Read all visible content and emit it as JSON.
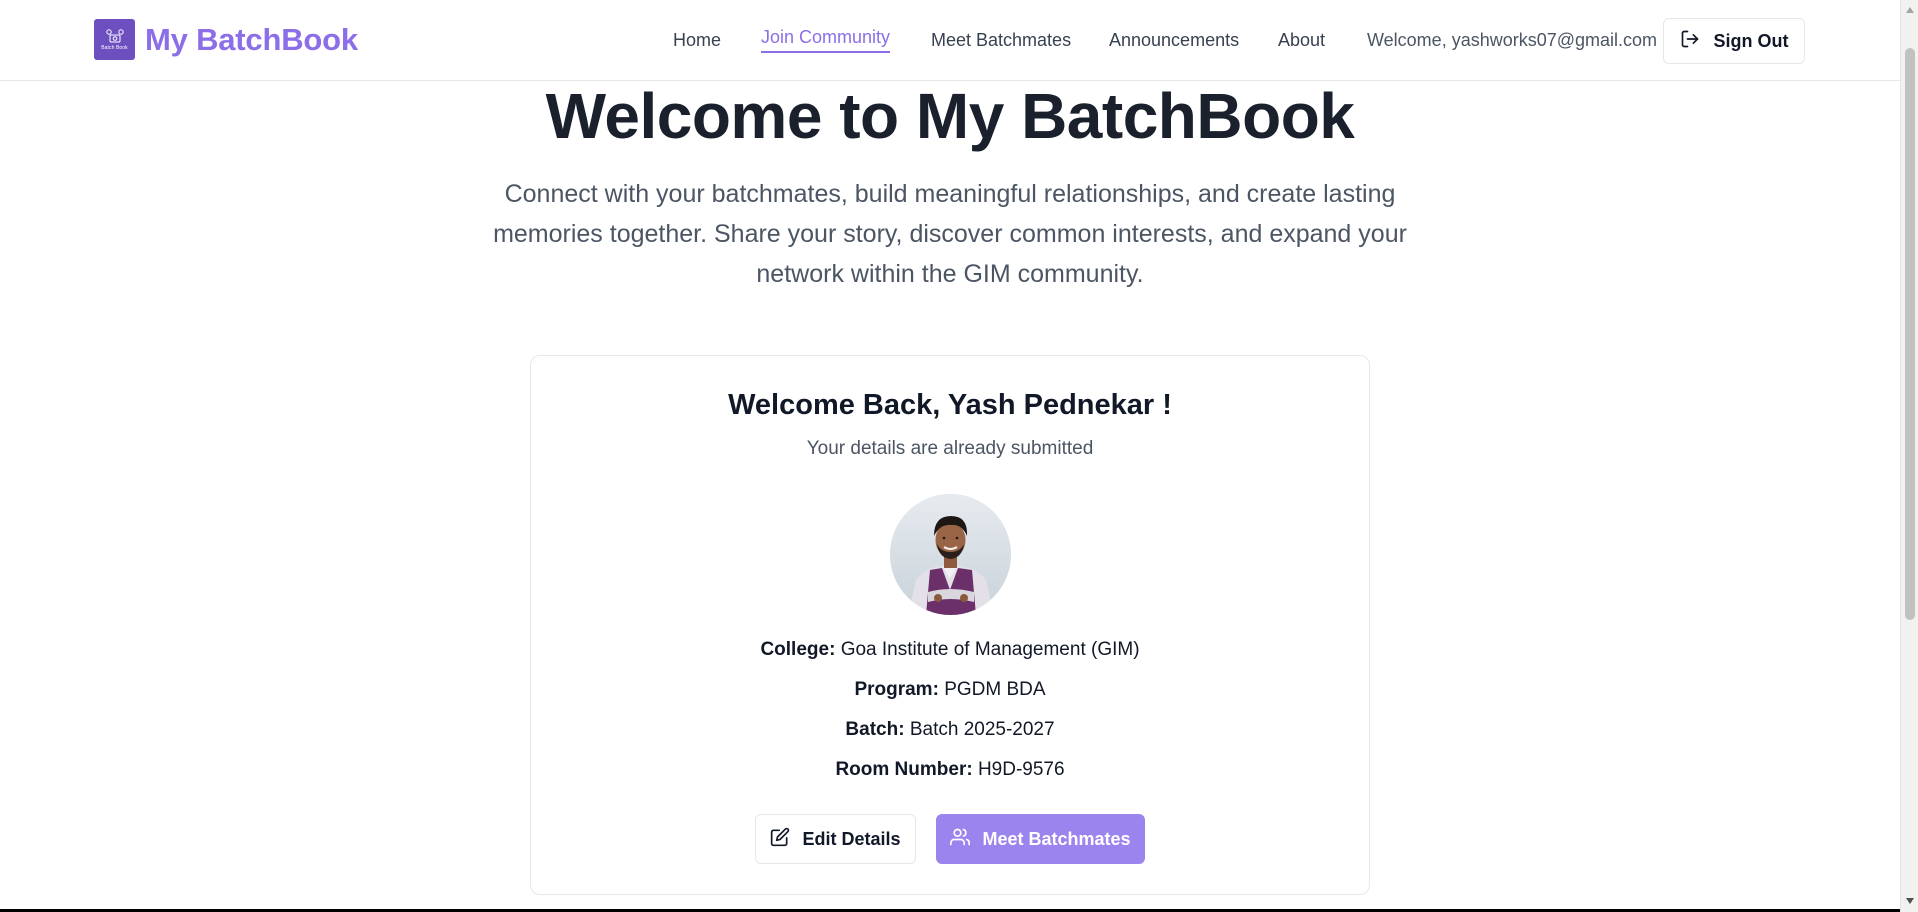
{
  "brand": {
    "name": "My BatchBook",
    "logo_caption": "Batch Book"
  },
  "nav": {
    "home": "Home",
    "join_community": "Join Community",
    "meet_batchmates": "Meet Batchmates",
    "announcements": "Announcements",
    "about": "About",
    "active": "join_community",
    "welcome_user": "Welcome, yashworks07@gmail.com",
    "sign_out": "Sign Out"
  },
  "hero": {
    "title": "Welcome to My BatchBook",
    "subtitle_line1": "Connect with your batchmates, build meaningful relationships, and create lasting",
    "subtitle_line2": "memories together. Share your story, discover common interests, and expand your",
    "subtitle_line3": "network within the GIM community."
  },
  "profile_card": {
    "title": "Welcome Back, Yash Pednekar !",
    "subtitle": "Your details are already submitted",
    "details": {
      "college_label": "College:",
      "college_value": "Goa Institute of Management (GIM)",
      "program_label": "Program:",
      "program_value": "PGDM BDA",
      "batch_label": "Batch:",
      "batch_value": "Batch 2025-2027",
      "room_label": "Room Number:",
      "room_value": "H9D-9576"
    },
    "edit_button": "Edit Details",
    "meet_button": "Meet Batchmates"
  },
  "colors": {
    "accent": "#8b6ee8",
    "primary_button": "#9c84ee",
    "logo_bg": "#6d4fc0",
    "heading": "#1a202c",
    "muted_text": "#4b5563"
  },
  "icons": {
    "logo": "batchbook-logo-icon",
    "sign_out": "sign-out-icon",
    "edit": "edit-icon",
    "meet": "users-icon"
  }
}
